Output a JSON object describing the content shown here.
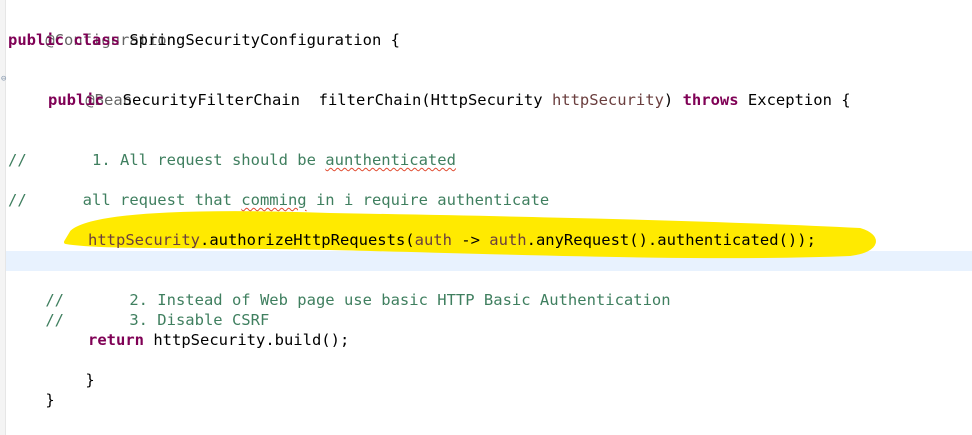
{
  "editor": {
    "fold_marker": "⊖",
    "lines": {
      "l1_annotation": "@Configuration",
      "l2_kw1": "public",
      "l2_kw2": "class",
      "l2_rest": " SpringSecurityConfiguration {",
      "l4_annotation": "@Bean",
      "l5_kw1": "public",
      "l5_mid": "  SecurityFilterChain  filterChain(HttpSecurity ",
      "l5_param": "httpSecurity",
      "l5_close": ") ",
      "l5_kw2": "throws",
      "l5_rest": " Exception {",
      "l7_comment_prefix": "//       1. All request should be ",
      "l7_comment_misspelled": "aunthenticated",
      "l9_comment_prefix": "//      all request that ",
      "l9_comment_misspelled": "comming",
      "l9_comment_suffix": " in i require authenticate",
      "l11_param1": "httpSecurity",
      "l11_mid": ".authorizeHttpRequests(",
      "l11_param2": "auth",
      "l11_arrow": " -> ",
      "l11_param3": "auth",
      "l11_rest": ".anyRequest().authenticated());",
      "l13_comment": "//       2. Instead of Web page use basic HTTP Basic Authentication",
      "l14_comment": "//       3. Disable CSRF",
      "l16_kw": "return",
      "l16_rest": " httpSecurity.build();",
      "l17_brace": "}",
      "l18_brace": "}"
    },
    "colors": {
      "keyword": "#7f0055",
      "comment": "#3f7f5f",
      "annotation": "#646464",
      "parameter": "#6a3e3e",
      "current_line": "#e8f2fe",
      "highlighter": "#ffea00"
    }
  }
}
